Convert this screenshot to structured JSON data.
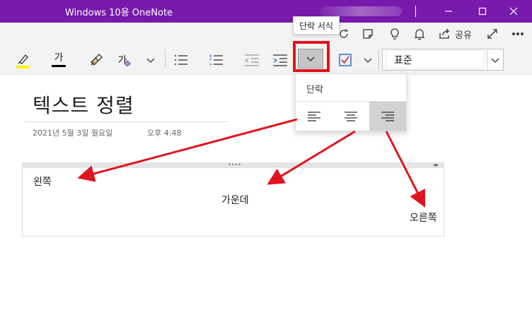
{
  "window": {
    "title": "Windows 10용 OneNote"
  },
  "top_toolbar": {
    "share_label": "공유"
  },
  "toolbar": {
    "font_color_glyph": "가",
    "clear_format_glyph": "가",
    "style_value": "표준"
  },
  "tooltip": {
    "text": "단락 서식"
  },
  "paragraph_menu": {
    "title": "단락",
    "selected_alignment": "right"
  },
  "page": {
    "title": "텍스트 정렬",
    "date": "2021년 5월 3일 월요일",
    "time": "오후 4:48"
  },
  "note": {
    "left_text": "왼쪽",
    "center_text": "가운데",
    "right_text": "오른쪽"
  },
  "colors": {
    "titlebar": "#7719aa",
    "highlight_red": "#e0141e",
    "highlighter_yellow": "#fff100",
    "checkbox_red": "#d13438",
    "checkbox_blue": "#2b63c6"
  }
}
